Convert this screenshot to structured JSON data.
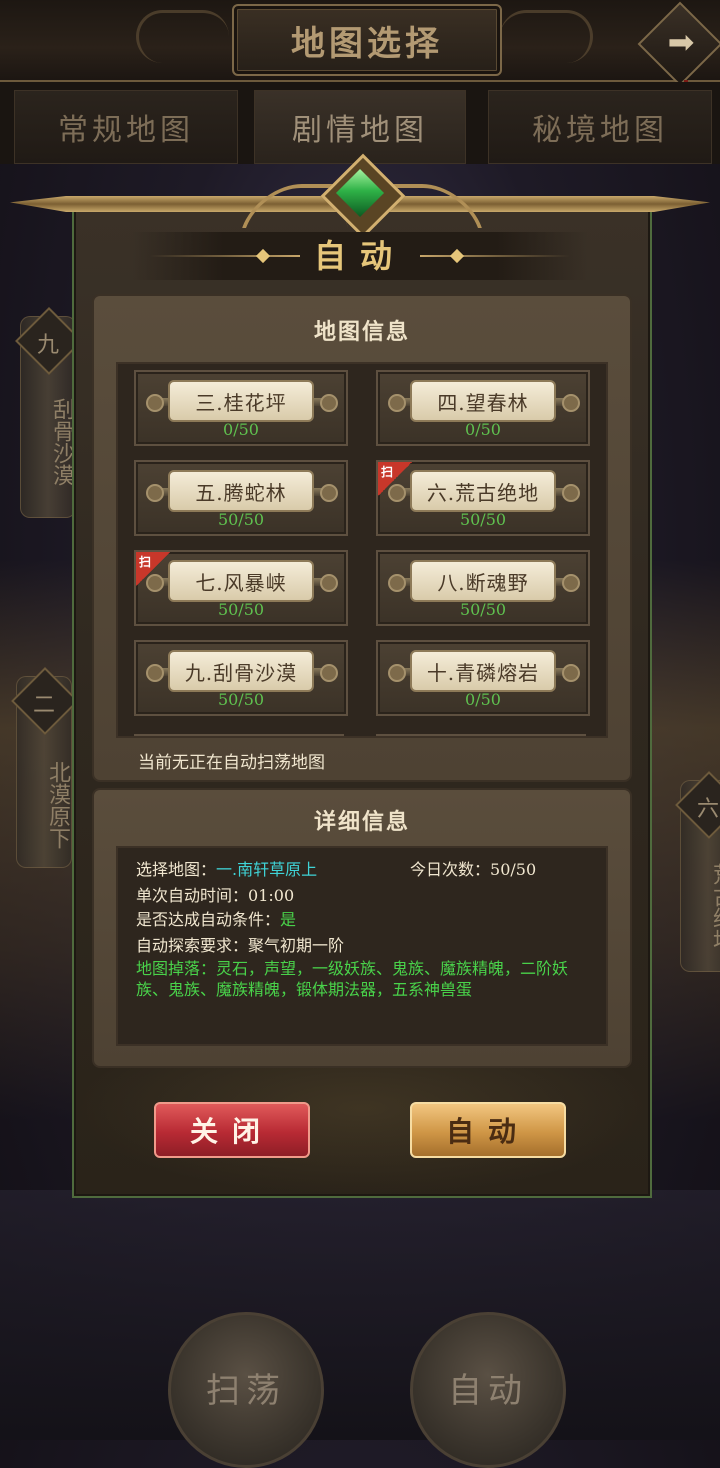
{
  "header": {
    "title": "地图选择",
    "next_icon": "arrow-right-icon"
  },
  "tabs": [
    {
      "label": "常规地图",
      "active": false
    },
    {
      "label": "剧情地图",
      "active": true
    },
    {
      "label": "秘境地图",
      "active": false
    }
  ],
  "side_left": [
    {
      "number": "九",
      "name": "刮骨沙漠"
    },
    {
      "number": "二",
      "name": "北漠原下"
    }
  ],
  "side_right": [
    {
      "number": "六",
      "name": "荒古绝地"
    }
  ],
  "panel": {
    "title": "自动",
    "map_info_title": "地图信息",
    "maps": [
      {
        "name": "三.桂花坪",
        "count": "0/50",
        "sweep_tag": false
      },
      {
        "name": "四.望春林",
        "count": "0/50",
        "sweep_tag": false
      },
      {
        "name": "五.腾蛇林",
        "count": "50/50",
        "sweep_tag": false
      },
      {
        "name": "六.荒古绝地",
        "count": "50/50",
        "sweep_tag": true
      },
      {
        "name": "七.风暴峡",
        "count": "50/50",
        "sweep_tag": true
      },
      {
        "name": "八.断魂野",
        "count": "50/50",
        "sweep_tag": false
      },
      {
        "name": "九.刮骨沙漠",
        "count": "50/50",
        "sweep_tag": false
      },
      {
        "name": "十.青磷熔岩",
        "count": "0/50",
        "sweep_tag": false
      }
    ],
    "sweep_tag_text": "扫",
    "current_status": "当前无正在自动扫荡地图",
    "detail_title": "详细信息",
    "detail": {
      "select_label": "选择地图：",
      "select_value": "一.南轩草原上",
      "daily_label": "今日次数：",
      "daily_value": "50/50",
      "time_label": "单次自动时间：",
      "time_value": "01:00",
      "condition_label": "是否达成自动条件：",
      "condition_value": "是",
      "requirement_label": "自动探索要求：",
      "requirement_value": "聚气初期一阶",
      "drops_label": "地图掉落：",
      "drops_value": "灵石，声望，一级妖族、鬼族、魔族精魄，二阶妖族、鬼族、魔族精魄，锻体期法器，五系神兽蛋"
    },
    "close_button": "关闭",
    "auto_button": "自动"
  },
  "bottom": {
    "sweep_button": "扫荡",
    "auto_button": "自动"
  },
  "colors": {
    "gold": "#e6c67a",
    "count_green": "#5fc04f",
    "cyan": "#3fd3d6",
    "close_red": "#b82a34",
    "auto_gold": "#cf9646"
  }
}
